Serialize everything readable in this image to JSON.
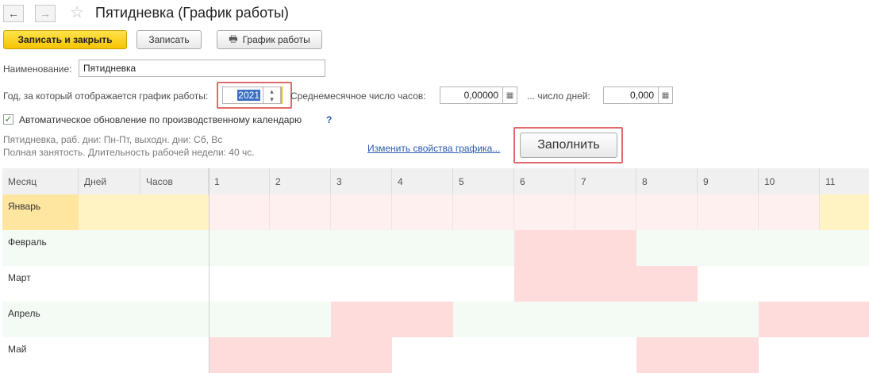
{
  "window": {
    "title": "Пятидневка (График работы)"
  },
  "nav": {
    "back_glyph": "←",
    "forward_glyph": "→",
    "star_glyph": "☆"
  },
  "toolbar": {
    "save_close_label": "Записать и закрыть",
    "save_label": "Записать",
    "schedule_label": "График работы",
    "print_glyph": "🖶"
  },
  "form": {
    "name_label": "Наименование:",
    "name_value": "Пятидневка",
    "year_label": "Год, за который отображается график работы:",
    "year_value": "2021",
    "avg_hours_label": "Среднемесячное число часов:",
    "avg_hours_value": "0,00000",
    "days_label": "... число дней:",
    "days_value": "0,000",
    "auto_update_label": "Автоматическое обновление по производственному календарю",
    "help_glyph": "?",
    "check_glyph": "✓",
    "calc_glyph": "▦",
    "spin_up": "▴",
    "spin_down": "▾",
    "desc_line1": "Пятидневка, раб. дни: Пн-Пт, выходн. дни: Сб, Вс",
    "desc_line2": "Полная занятость. Длительность рабочей недели: 40 чс.",
    "change_link": "Изменить свойства графика...",
    "fill_button": "Заполнить"
  },
  "table": {
    "headers": [
      "Месяц",
      "Дней",
      "Часов",
      "1",
      "2",
      "3",
      "4",
      "5",
      "6",
      "7",
      "8",
      "9",
      "10",
      "11"
    ],
    "rows": [
      {
        "month": "Январь",
        "weekend": [
          1,
          1,
          1,
          1,
          1,
          1,
          1,
          1,
          1,
          1,
          0
        ]
      },
      {
        "month": "Февраль",
        "weekend": [
          0,
          0,
          0,
          0,
          0,
          1,
          1,
          0,
          0,
          0,
          0
        ]
      },
      {
        "month": "Март",
        "weekend": [
          0,
          0,
          0,
          0,
          0,
          1,
          1,
          1,
          0,
          0,
          0
        ]
      },
      {
        "month": "Апрель",
        "weekend": [
          0,
          0,
          1,
          1,
          0,
          0,
          0,
          0,
          0,
          1,
          1
        ]
      },
      {
        "month": "Май",
        "weekend": [
          1,
          1,
          1,
          0,
          0,
          0,
          0,
          1,
          1,
          0,
          0
        ]
      }
    ],
    "colors": {
      "header_bg": "#f0f0f0",
      "selected_row_bg": "#fff3c4",
      "selected_cell_bg": "#ffe6a0",
      "weekend_bg": "#ffdcdc",
      "light_weekend_bg": "#fff0f0",
      "even_row_bg": "#f4faf4",
      "odd_row_bg": "#ffffff"
    }
  }
}
